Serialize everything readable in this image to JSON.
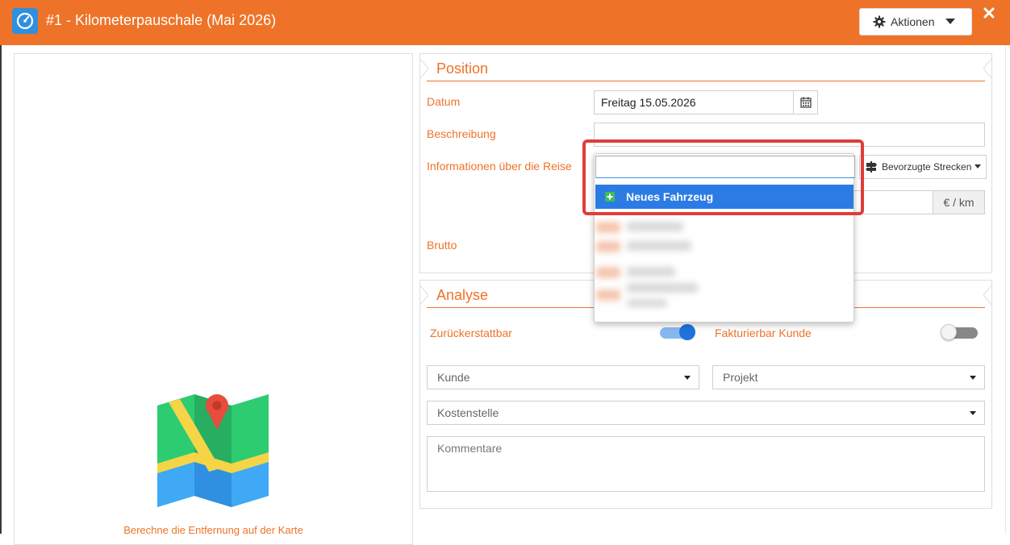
{
  "header": {
    "title": "#1 -  Kilometerpauschale (Mai 2026)",
    "actions_label": "Aktionen",
    "brand_color": "#ee7328"
  },
  "map": {
    "link_text": "Berechne die Entfernung auf der Karte"
  },
  "position": {
    "title": "Position",
    "datum_label": "Datum",
    "datum_value": "Freitag 15.05.2026",
    "beschreibung_label": "Beschreibung",
    "beschreibung_value": "",
    "reise_label": "Informationen über die Reise",
    "preferred_routes_label": "Bevorzugte Strecken",
    "rate_unit": "€ / km",
    "brutto_label": "Brutto"
  },
  "vehicle_dropdown": {
    "search_value": "",
    "new_vehicle_label": "Neues Fahrzeug"
  },
  "analyse": {
    "title": "Analyse",
    "reimbursable_label": "Zurückerstattbar",
    "reimbursable_on": true,
    "billable_label": "Fakturierbar Kunde",
    "billable_on": false,
    "kunde_placeholder": "Kunde",
    "projekt_placeholder": "Projekt",
    "kostenstelle_placeholder": "Kostenstelle",
    "kommentare_placeholder": "Kommentare"
  },
  "icons": {
    "app": "speedometer-icon",
    "actions": "gear-icon",
    "close": "close-icon",
    "calendar": "calendar-icon",
    "routes": "signpost-icon",
    "new_vehicle": "plus-square-icon",
    "map": "map-icon"
  }
}
